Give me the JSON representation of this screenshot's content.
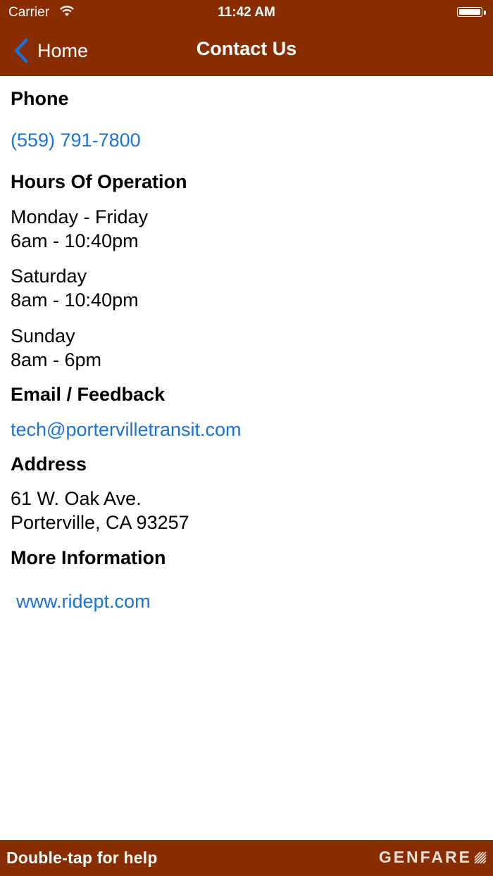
{
  "status_bar": {
    "carrier": "Carrier",
    "time": "11:42 AM"
  },
  "nav": {
    "back_label": "Home",
    "title": "Contact Us"
  },
  "contact": {
    "phone_heading": "Phone",
    "phone": "(559) 791-7800",
    "hours_heading": "Hours Of Operation",
    "hours": [
      {
        "days": "Monday - Friday",
        "time": "6am - 10:40pm"
      },
      {
        "days": "Saturday",
        "time": "8am - 10:40pm"
      },
      {
        "days": "Sunday",
        "time": "8am - 6pm"
      }
    ],
    "email_heading": "Email / Feedback",
    "email": "tech@portervilletransit.com",
    "address_heading": "Address",
    "address_line1": "61 W. Oak Ave.",
    "address_line2": "Porterville, CA 93257",
    "more_heading": "More Information",
    "website": "www.ridept.com"
  },
  "footer": {
    "help_text": "Double-tap for help",
    "brand": "GENFARE"
  },
  "colors": {
    "bar_background": "#882d00",
    "link": "#1a73d9",
    "back_chevron": "#1a73d9"
  }
}
